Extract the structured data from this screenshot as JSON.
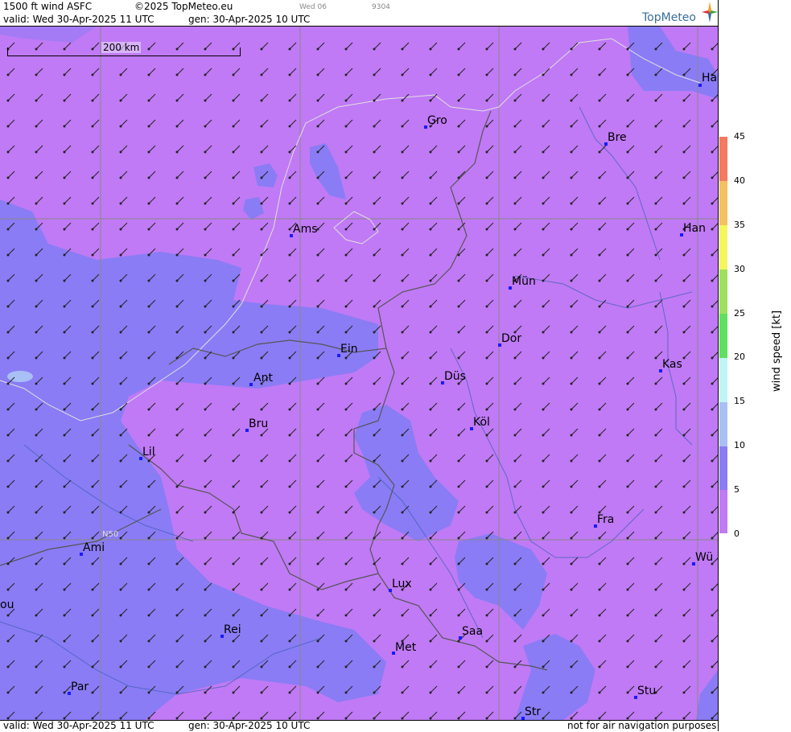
{
  "header": {
    "product": "1500 ft wind ASFC",
    "copyright": "©2025 TopMeteo.eu",
    "day_tag": "Wed 06",
    "code": "9304",
    "valid": "valid:  Wed  30-Apr-2025  11 UTC",
    "gen": "gen: 30-Apr-2025 10 UTC",
    "brand": "TopMeteo"
  },
  "footer": {
    "valid": "valid:  Wed  30-Apr-2025  11 UTC",
    "gen": "gen: 30-Apr-2025 10 UTC",
    "disclaimer": "not for air navigation purposes"
  },
  "scale": {
    "label": "200 km"
  },
  "grid": {
    "lat_label": "N50"
  },
  "legend": {
    "title": "wind speed  [kt]",
    "ticks": [
      "45",
      "40",
      "35",
      "30",
      "25",
      "20",
      "15",
      "10",
      "5",
      "0"
    ],
    "colors": {
      "0-5": "#c07af5",
      "5-10": "#8a7cf5",
      "10-15": "#a8c0f5",
      "15-20": "#c0f5f5",
      "20-25": "#60e060",
      "25-30": "#a0e060",
      "30-35": "#f5f560",
      "35-40": "#f5c060",
      "40-45": "#f57a60"
    }
  },
  "cities": [
    {
      "name": "Ha"
    },
    {
      "name": "Gro"
    },
    {
      "name": "Bre"
    },
    {
      "name": "Ams"
    },
    {
      "name": "Han"
    },
    {
      "name": "Mün"
    },
    {
      "name": "Ein"
    },
    {
      "name": "Dor"
    },
    {
      "name": "Kas"
    },
    {
      "name": "Ant"
    },
    {
      "name": "Düs"
    },
    {
      "name": "Bru"
    },
    {
      "name": "Köl"
    },
    {
      "name": "Lil"
    },
    {
      "name": "Fra"
    },
    {
      "name": "Ami"
    },
    {
      "name": "Wü"
    },
    {
      "name": "Lux"
    },
    {
      "name": "ou"
    },
    {
      "name": "Rei"
    },
    {
      "name": "Saa"
    },
    {
      "name": "Met"
    },
    {
      "name": "Par"
    },
    {
      "name": "Stu"
    },
    {
      "name": "Str"
    }
  ]
}
